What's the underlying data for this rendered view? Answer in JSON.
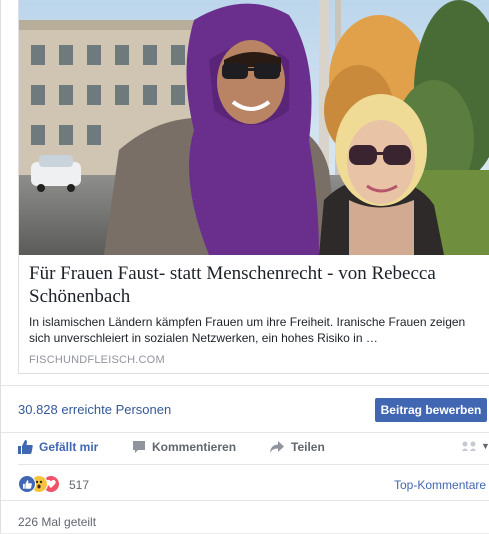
{
  "link_preview": {
    "title": "Für Frauen Faust- statt Menschenrecht - von Rebecca Schönenbach",
    "description": "In islamischen Ländern kämpfen Frauen um ihre Freiheit. Iranische Frauen zeigen sich unverschleiert in sozialen Netzwerken, ein hohes Risiko in …",
    "domain": "FISCHUNDFLEISCH.COM"
  },
  "reach": {
    "text": "30.828 erreichte Personen",
    "boost_button": "Beitrag bewerben"
  },
  "actions": {
    "like": "Gefällt mir",
    "comment": "Kommentieren",
    "share": "Teilen"
  },
  "reactions": {
    "count": "517",
    "types": [
      "like",
      "wow",
      "love"
    ],
    "sort_label": "Top-Kommentare"
  },
  "shares": {
    "text": "226 Mal geteilt"
  },
  "colors": {
    "accent": "#4267b2",
    "link": "#365899",
    "muted": "#616770",
    "headscarf": "#6a2f8c"
  }
}
